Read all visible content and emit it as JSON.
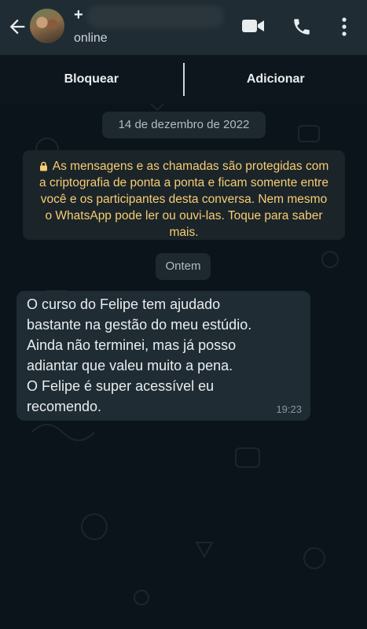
{
  "header": {
    "contact_name": "+",
    "status": "online",
    "icons": [
      "back-arrow-icon",
      "video-call-icon",
      "phone-icon",
      "more-vertical-icon"
    ]
  },
  "actions": {
    "block_label": "Bloquear",
    "add_label": "Adicionar"
  },
  "chat": {
    "date_chip": "14 de dezembro de 2022",
    "encryption_notice": "As mensagens e as chamadas são protegidas com a criptografia de ponta a ponta e ficam somente entre você e os participantes desta conversa. Nem mesmo o WhatsApp pode ler ou ouvi-las. Toque para saber mais.",
    "day_chip": "Ontem",
    "message": {
      "text": "O curso do Felipe tem ajudado\nbastante na gestão do meu estúdio.\nAinda não terminei, mas já posso\nadiantar que valeu muito a pena.\nO Felipe é super acessível eu\nrecomendo.",
      "time": "19:23"
    }
  },
  "colors": {
    "background": "#0b141a",
    "header": "#1f2c34",
    "notice_text": "#f7cd73",
    "bubble": "#1f2c34"
  }
}
